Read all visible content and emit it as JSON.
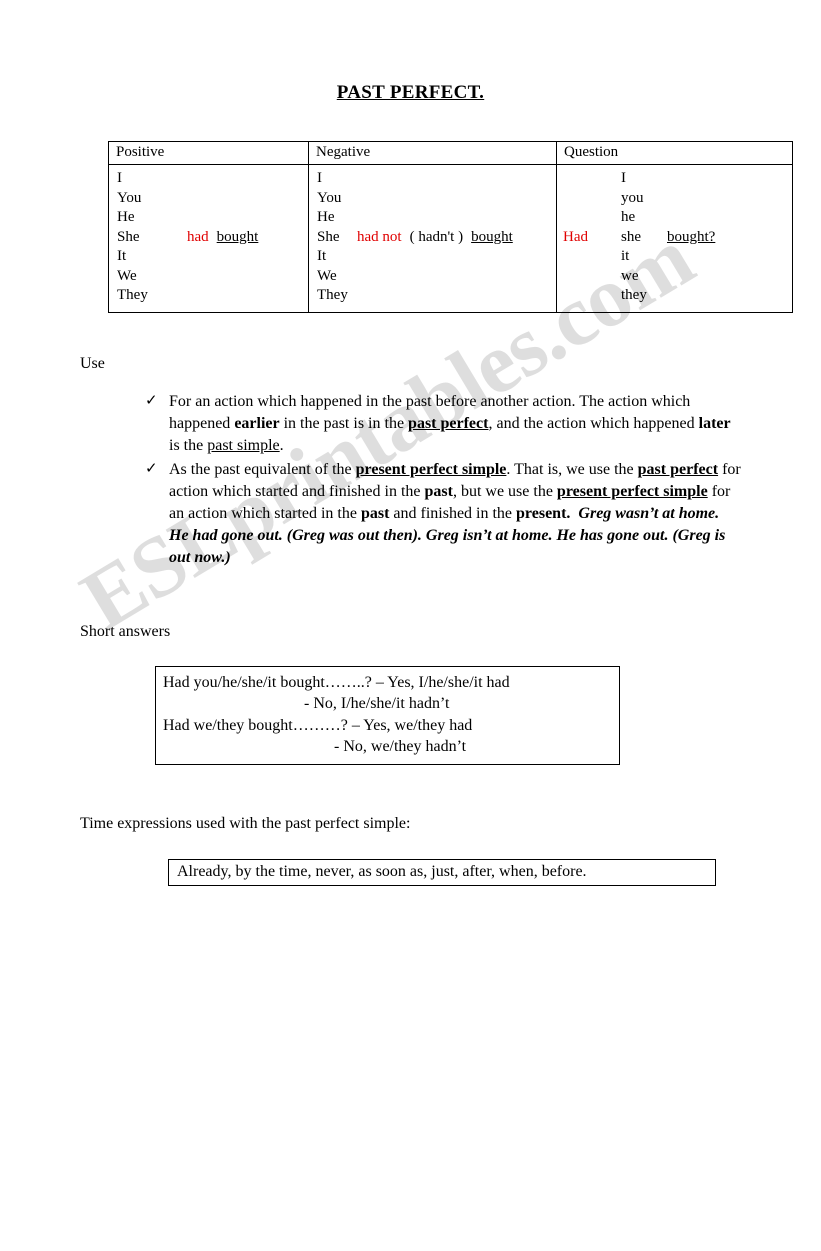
{
  "document": {
    "title": "PAST PERFECT."
  },
  "conjugation_table": {
    "headers": [
      "Positive",
      "Negative",
      "Question"
    ],
    "positive": {
      "pronouns": [
        "I",
        "You",
        "He",
        "She",
        "It",
        "We",
        "They"
      ],
      "aux": "had",
      "verb": "bought"
    },
    "negative": {
      "pronouns": [
        "I",
        "You",
        "He",
        "She",
        "It",
        "We",
        "They"
      ],
      "aux": "had not",
      "contraction": "( hadn't )",
      "verb": "bought"
    },
    "question": {
      "aux": "Had",
      "pronouns": [
        "I",
        "you",
        "he",
        "she",
        "it",
        "we",
        "they"
      ],
      "verb": "bought?"
    }
  },
  "use_section": {
    "label": "Use",
    "bullet_icon": "check-tick-icon",
    "items": [
      {
        "parts": [
          {
            "text": "For an action which happened in the past before another action. The action which happened ",
            "style": "normal"
          },
          {
            "text": "earlier",
            "style": "bold"
          },
          {
            "text": " in the past is in the ",
            "style": "normal"
          },
          {
            "text": "past perfect",
            "style": "bold-underline"
          },
          {
            "text": ", and the action which happened ",
            "style": "normal"
          },
          {
            "text": "later",
            "style": "bold"
          },
          {
            "text": " is the ",
            "style": "normal"
          },
          {
            "text": "past simple",
            "style": "underline"
          },
          {
            "text": ".",
            "style": "normal"
          }
        ]
      },
      {
        "parts": [
          {
            "text": "As the past equivalent of the ",
            "style": "normal"
          },
          {
            "text": "present perfect simple",
            "style": "bold-underline"
          },
          {
            "text": ". That is, we use the ",
            "style": "normal"
          },
          {
            "text": "past perfect",
            "style": "bold-underline"
          },
          {
            "text": " for action which started and finished in the ",
            "style": "normal"
          },
          {
            "text": "past",
            "style": "bold"
          },
          {
            "text": ", but we use the ",
            "style": "normal"
          },
          {
            "text": "present perfect simple",
            "style": "bold-underline"
          },
          {
            "text": " for an action which started in the ",
            "style": "normal"
          },
          {
            "text": "past",
            "style": "bold"
          },
          {
            "text": " and finished in the ",
            "style": "normal"
          },
          {
            "text": "present.",
            "style": "bold"
          },
          {
            "text": "  Greg wasn't at home. He had gone out. (Greg was out then). Greg isn't at home. He has gone out. (Greg is out now.)",
            "style": "bold-italic"
          }
        ]
      }
    ]
  },
  "short_answers": {
    "label": "Short answers",
    "lines": [
      "Had you/he/she/it bought……..? – Yes, I/he/she/it had",
      "-  No, I/he/she/it hadn’t",
      "Had we/they bought………? – Yes, we/they had",
      "- No, we/they hadn’t"
    ]
  },
  "time_expressions": {
    "label": "Time expressions used with the past perfect simple:",
    "content": "Already, by the time, never, as soon as, just, after, when, before."
  },
  "watermark": {
    "text": "ESLprintables.com"
  },
  "colors": {
    "auxiliary_red": "#e00000",
    "text": "#000000",
    "background": "#ffffff"
  }
}
